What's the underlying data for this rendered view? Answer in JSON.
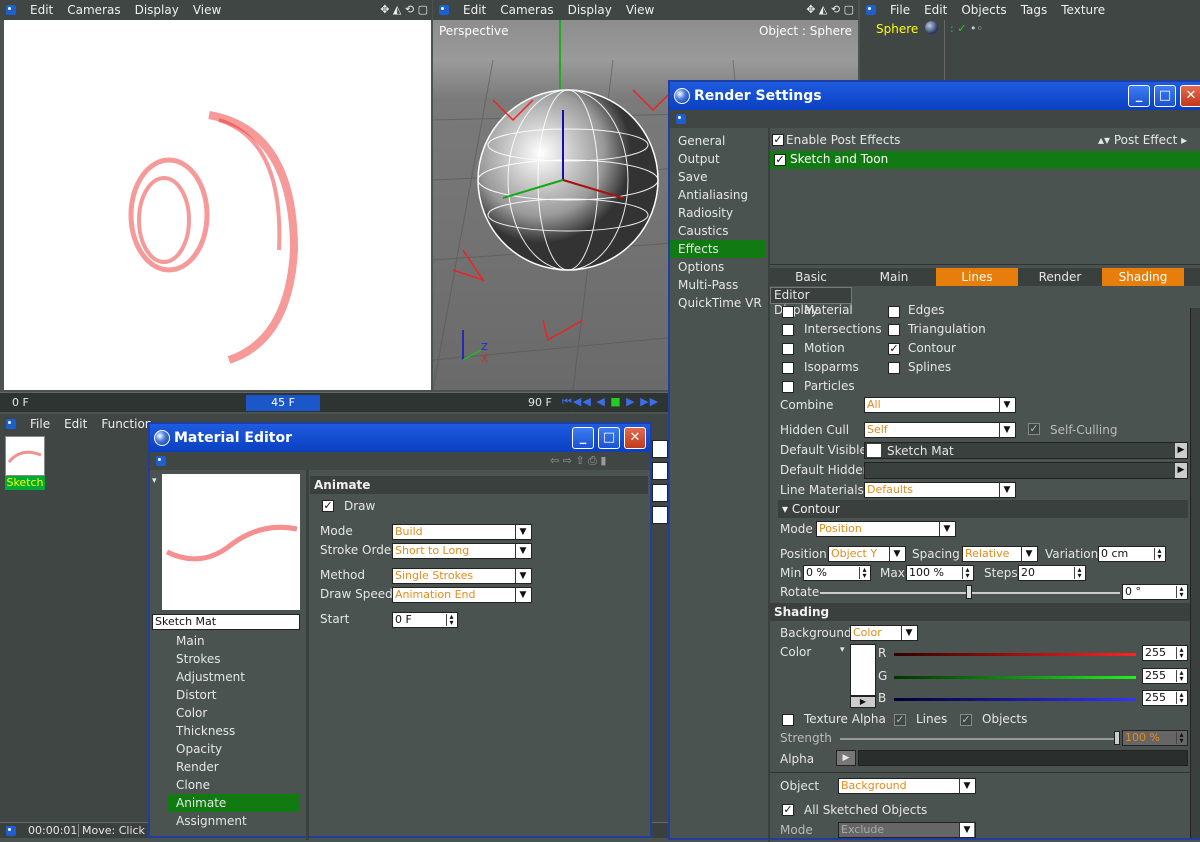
{
  "vp1": {
    "menu": [
      "Edit",
      "Cameras",
      "Display",
      "View"
    ]
  },
  "vp2": {
    "menu": [
      "Edit",
      "Cameras",
      "Display",
      "View"
    ],
    "label": "Perspective",
    "object": "Object : Sphere",
    "axis_z": "Z",
    "axis_x": "X"
  },
  "om": {
    "menu": [
      "File",
      "Edit",
      "Objects",
      "Tags",
      "Texture"
    ],
    "object": "Sphere"
  },
  "timeline": {
    "start": "0 F",
    "current": "45 F",
    "end": "90 F"
  },
  "matmgr": {
    "menu": [
      "File",
      "Edit",
      "Function"
    ],
    "mat_label": "Sketch"
  },
  "status": {
    "time": "00:00:01",
    "message": "Move: Click a"
  },
  "mated": {
    "title": "Material Editor",
    "name": "Sketch Mat",
    "nav": [
      "Main",
      "Strokes",
      "Adjustment",
      "Distort",
      "Color",
      "Thickness",
      "Opacity",
      "Render",
      "Clone",
      "Animate",
      "Assignment"
    ],
    "selected": "Animate",
    "section": "Animate",
    "draw_label": "Draw",
    "mode_label": "Mode",
    "mode": "Build",
    "stroke_order_label": "Stroke Order",
    "stroke_order": "Short to Long",
    "method_label": "Method",
    "method": "Single Strokes",
    "draw_speed_label": "Draw Speed",
    "draw_speed": "Animation End",
    "start_label": "Start",
    "start": "0 F"
  },
  "rs": {
    "title": "Render Settings",
    "nav": [
      "General",
      "Output",
      "Save",
      "Antialiasing",
      "Radiosity",
      "Caustics",
      "Effects",
      "Options",
      "Multi-Pass",
      "QuickTime VR"
    ],
    "selected": "Effects",
    "enable_post": "Enable Post Effects",
    "post_effect": "Post Effect",
    "effect_item": "Sketch and Toon",
    "tabs": [
      "Basic",
      "Main",
      "Lines",
      "Render",
      "Shading"
    ],
    "editor_display": "Editor Display",
    "checks": {
      "material": "Material",
      "edges": "Edges",
      "intersections": "Intersections",
      "triangulation": "Triangulation",
      "motion": "Motion",
      "contour": "Contour",
      "isoparms": "Isoparms",
      "splines": "Splines",
      "particles": "Particles"
    },
    "combine_label": "Combine",
    "combine": "All",
    "hidden_cull_label": "Hidden Cull",
    "hidden_cull": "Self",
    "self_culling": "Self-Culling",
    "default_visible_label": "Default Visible",
    "default_visible": "Sketch Mat",
    "default_hidden_label": "Default Hidden",
    "line_materials_label": "Line Materials",
    "line_materials": "Defaults",
    "contour_hdr": "▾ Contour",
    "cmode_label": "Mode",
    "cmode": "Position",
    "position_label": "Position",
    "position": "Object Y",
    "spacing_label": "Spacing",
    "spacing": "Relative",
    "variation_label": "Variation",
    "variation": "0 cm",
    "min_label": "Min",
    "min": "0 %",
    "max_label": "Max",
    "max": "100 %",
    "steps_label": "Steps",
    "steps": "20",
    "rotate_label": "Rotate",
    "rotate": "0 °",
    "shading_hdr": "Shading",
    "background_label": "Background",
    "background": "Color",
    "color_label": "Color",
    "r": "R",
    "g": "G",
    "b": "B",
    "r_val": "255",
    "g_val": "255",
    "b_val": "255",
    "texture_alpha": "Texture Alpha",
    "lines": "Lines",
    "objects": "Objects",
    "strength_label": "Strength",
    "strength": "100 %",
    "alpha_label": "Alpha",
    "object_label": "Object",
    "object": "Background",
    "all_sketched": "All Sketched Objects",
    "mode2_label": "Mode",
    "mode2": "Exclude"
  },
  "colors": {
    "accent_green": "#117a12",
    "tab_orange": "#e77e0b",
    "xp_blue": "#0a3fc0"
  }
}
